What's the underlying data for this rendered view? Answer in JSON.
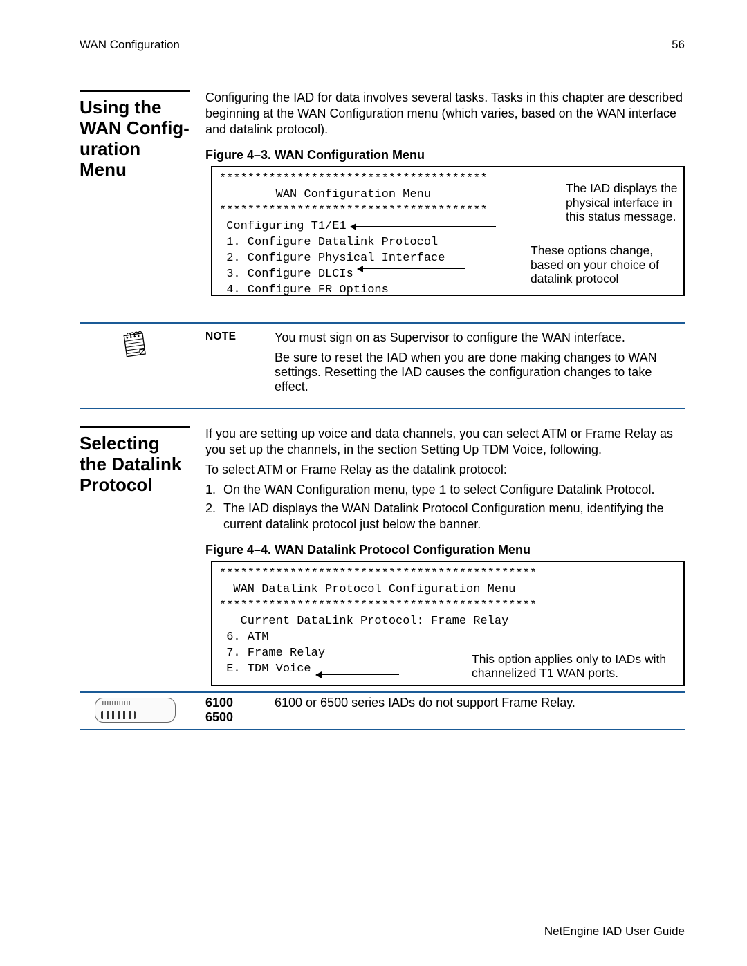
{
  "header": {
    "left": "WAN Configuration",
    "right": "56"
  },
  "sec1": {
    "heading": "Using the WAN Config-\nuration Menu",
    "intro": "Configuring the IAD for data involves several tasks. Tasks in this chapter are described beginning at the WAN Configuration menu (which varies, based on the WAN interface and datalink protocol).",
    "figcap": "Figure 4–3.  WAN Configuration Menu",
    "fig": {
      "l1": "**************************************",
      "l2": "        WAN Configuration Menu",
      "l3": "**************************************",
      "l4": " Configuring T1/E1",
      "l5": " 1. Configure Datalink Protocol",
      "l6": " 2. Configure Physical Interface",
      "l7": " 3. Configure DLCIs",
      "l8": " 4. Configure FR Options"
    },
    "annot1": "The IAD displays the physical interface in this status message.",
    "annot2": "These options change, based on your choice of datalink protocol"
  },
  "note": {
    "label": "NOTE",
    "p1": "You must sign on as Supervisor to configure the WAN interface.",
    "p2": "Be sure to reset the IAD when you are done making changes to WAN settings. Resetting the IAD causes the configuration changes to take effect."
  },
  "sec2": {
    "heading": "Selecting the Datalink Protocol",
    "p1": "If you are setting up voice and data channels, you can select ATM or Frame Relay as you set up the channels, in the section Setting Up TDM Voice, following.",
    "p2": "To select ATM or Frame Relay as the datalink protocol:",
    "li1a": "On the WAN Configuration menu, type ",
    "li1code": "1",
    "li1b": " to select Configure Datalink Protocol.",
    "li2": "The IAD displays the WAN Datalink Protocol Configuration menu, identifying the current datalink protocol just below the banner.",
    "figcap": "Figure 4–4.  WAN Datalink Protocol Configuration Menu",
    "fig": {
      "l1": "*********************************************",
      "l2": "  WAN Datalink Protocol Configuration Menu",
      "l3": "*********************************************",
      "l4": "",
      "l5": "   Current DataLink Protocol: Frame Relay",
      "l6": "",
      "l7": " 6. ATM",
      "l8": " 7. Frame Relay",
      "l9": " E. TDM Voice"
    },
    "annot": "This option applies only to IADs with channelized T1 WAN ports."
  },
  "device": {
    "models": "6100\n6500",
    "text": "6100 or 6500 series IADs do not support Frame Relay."
  },
  "footer": "NetEngine IAD User Guide"
}
